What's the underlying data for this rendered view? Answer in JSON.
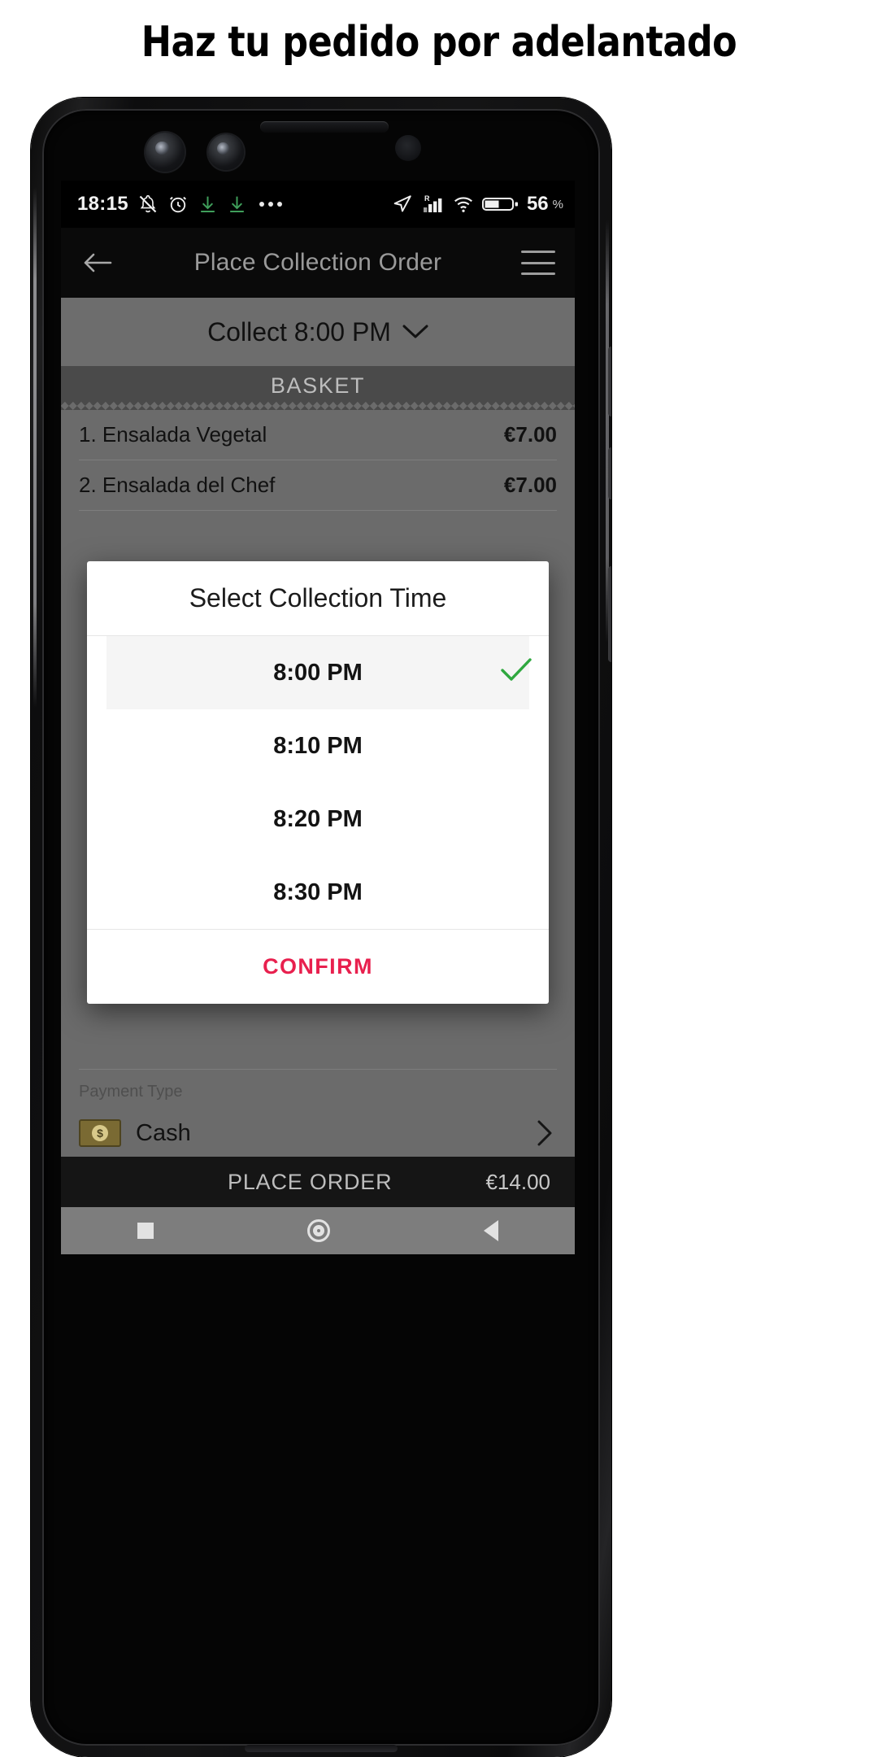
{
  "headline": "Haz tu pedido por adelantado",
  "colors": {
    "accent_confirm": "#e8204e",
    "check_green": "#2fa83f",
    "screen_scrim": "#6b6b6b",
    "appbar_bg": "#0a0a0a",
    "dialog_bg": "#ffffff",
    "selected_row_bg": "#f5f5f5"
  },
  "statusbar": {
    "time": "18:15",
    "icons_left": [
      "bell-off-icon",
      "alarm-clock-icon",
      "download-arrow-icon",
      "download-arrow-icon",
      "more-dots-icon"
    ],
    "icons_right": [
      "location-arrow-icon",
      "signal-bars-roaming-icon",
      "wifi-icon",
      "battery-icon"
    ],
    "signal_roaming_label": "R",
    "battery_percent": "56",
    "battery_unit": "%"
  },
  "appbar": {
    "back_icon": "back-arrow-icon",
    "title": "Place Collection Order",
    "menu_icon": "hamburger-icon"
  },
  "collect_bar": {
    "label": "Collect 8:00 PM",
    "chevron_icon": "chevron-down-icon"
  },
  "basket": {
    "header": "BASKET",
    "items": [
      {
        "name": "1. Ensalada Vegetal",
        "price": "€7.00"
      },
      {
        "name": "2. Ensalada del Chef",
        "price": "€7.00"
      }
    ]
  },
  "payment": {
    "label": "Payment Type",
    "method": "Cash",
    "method_icon": "money-icon",
    "chevron_icon": "chevron-right-icon"
  },
  "place_order": {
    "label": "PLACE ORDER",
    "total": "€14.00"
  },
  "navbar": {
    "recents_icon": "square-recents-icon",
    "home_icon": "circle-home-icon",
    "back_icon": "triangle-back-icon"
  },
  "dialog": {
    "title": "Select Collection Time",
    "options": [
      {
        "time": "8:00 PM",
        "selected": true
      },
      {
        "time": "8:10 PM",
        "selected": false
      },
      {
        "time": "8:20 PM",
        "selected": false
      },
      {
        "time": "8:30 PM",
        "selected": false
      }
    ],
    "selected_check_icon": "check-icon",
    "confirm_label": "CONFIRM"
  }
}
